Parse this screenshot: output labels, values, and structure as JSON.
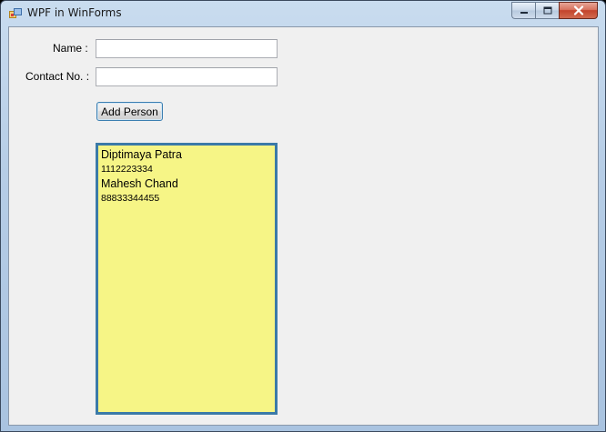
{
  "window": {
    "title": "WPF in WinForms",
    "icons": {
      "app": "app-window-icon",
      "minimize": "minimize-icon",
      "maximize": "maximize-icon",
      "close": "close-icon"
    }
  },
  "form": {
    "name_label": "Name :",
    "name_value": "",
    "contact_label": "Contact No. :",
    "contact_value": "",
    "add_button_label": "Add Person"
  },
  "people": [
    {
      "name": "Diptimaya Patra",
      "contact": "1112223334"
    },
    {
      "name": "Mahesh Chand",
      "contact": "88833344455"
    }
  ],
  "colors": {
    "panel_background": "#f6f586",
    "panel_border": "#3b7aa8",
    "form_background": "#f0f0f0",
    "close_button": "#c2432c"
  }
}
